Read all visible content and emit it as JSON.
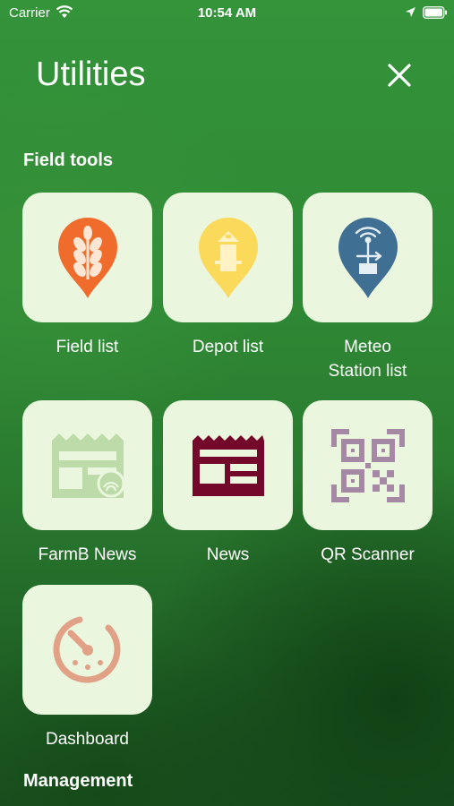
{
  "status_bar": {
    "carrier": "Carrier",
    "time": "10:54 AM"
  },
  "header": {
    "title": "Utilities",
    "close_icon": "close-icon"
  },
  "sections": {
    "field_tools": "Field tools",
    "management": "Management"
  },
  "tiles": [
    {
      "label": "Field list",
      "icon": "field-pin-icon",
      "color": "#ef6c2c"
    },
    {
      "label": "Depot list",
      "icon": "depot-pin-icon",
      "color": "#fad95b"
    },
    {
      "label": "Meteo\nStation list",
      "icon": "meteo-station-pin-icon",
      "color": "#3f6f93"
    },
    {
      "label": "FarmB News",
      "icon": "farmb-news-icon",
      "color": "#bcdba8"
    },
    {
      "label": "News",
      "icon": "newspaper-icon",
      "color": "#74082a"
    },
    {
      "label": "QR Scanner",
      "icon": "qr-scanner-icon",
      "color": "#a488a4"
    },
    {
      "label": "Dashboard",
      "icon": "dashboard-icon",
      "color": "#e1a187"
    }
  ]
}
